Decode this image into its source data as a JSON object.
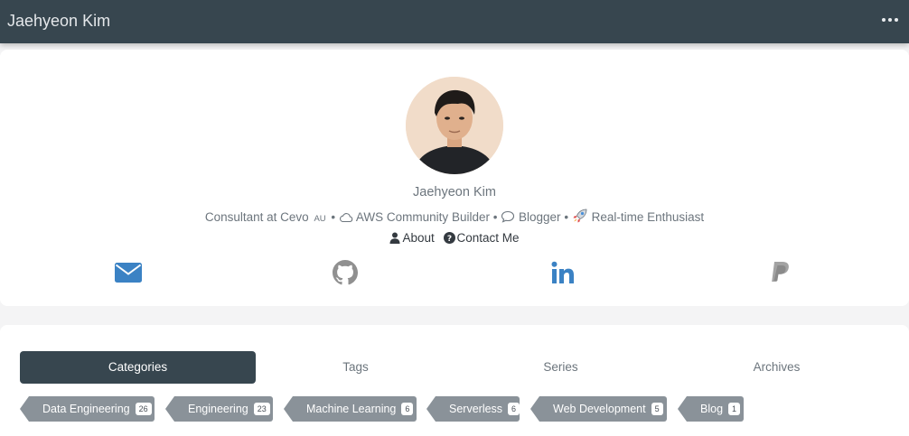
{
  "header": {
    "title": "Jaehyeon Kim",
    "menu_icon": "ellipsis-icon"
  },
  "profile": {
    "name": "Jaehyeon Kim",
    "bio": {
      "consultant": "Consultant at Cevo",
      "country": "AU",
      "community": "AWS Community Builder",
      "blogger": "Blogger",
      "enthusiast": "Real-time Enthusiast",
      "separator": "•"
    },
    "links": {
      "about": "About",
      "contact": "Contact Me"
    },
    "social": [
      {
        "name": "email",
        "icon": "envelope-icon",
        "color": "#3b82c4"
      },
      {
        "name": "github",
        "icon": "github-icon",
        "color": "#909090"
      },
      {
        "name": "linkedin",
        "icon": "linkedin-icon",
        "color": "#3b82c4"
      },
      {
        "name": "paypal",
        "icon": "paypal-icon",
        "color": "#9b9b9b"
      }
    ]
  },
  "tabs": [
    {
      "label": "Categories",
      "active": true
    },
    {
      "label": "Tags",
      "active": false
    },
    {
      "label": "Series",
      "active": false
    },
    {
      "label": "Archives",
      "active": false
    }
  ],
  "categories": [
    {
      "label": "Data Engineering",
      "count": "26"
    },
    {
      "label": "Engineering",
      "count": "23"
    },
    {
      "label": "Machine Learning",
      "count": "6"
    },
    {
      "label": "Serverless",
      "count": "6"
    },
    {
      "label": "Web Development",
      "count": "5"
    },
    {
      "label": "Blog",
      "count": "1"
    }
  ]
}
